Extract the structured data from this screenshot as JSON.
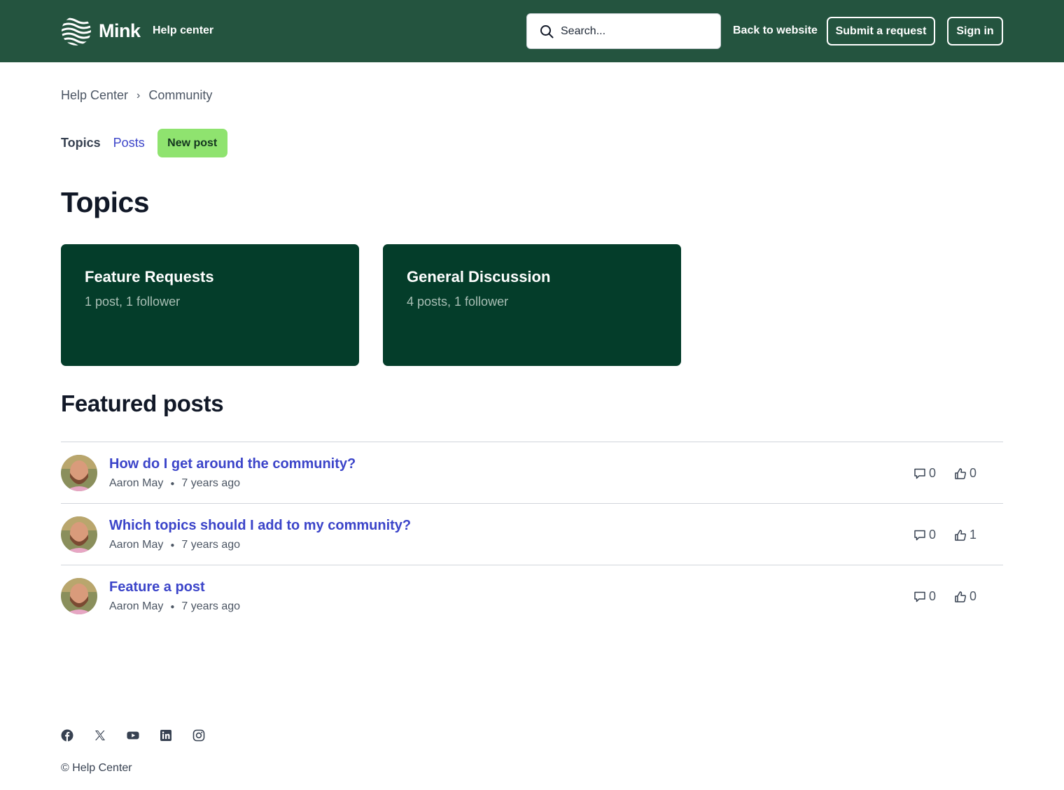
{
  "header": {
    "brand": "Mink",
    "help_center": "Help center",
    "search_placeholder": "Search...",
    "back_to_website": "Back to website",
    "submit_request": "Submit a request",
    "sign_in": "Sign in",
    "colors": {
      "header_bg": "#24543f",
      "card_bg": "#043d2a",
      "accent_button": "#8fe36f",
      "link": "#3b44c9"
    }
  },
  "breadcrumb": {
    "items": [
      "Help Center",
      "Community"
    ],
    "separator": "›"
  },
  "subnav": {
    "topics": "Topics",
    "posts": "Posts",
    "new_post": "New post"
  },
  "topics": {
    "heading": "Topics",
    "cards": [
      {
        "title": "Feature Requests",
        "meta": "1 post, 1 follower"
      },
      {
        "title": "General Discussion",
        "meta": "4 posts, 1 follower"
      }
    ]
  },
  "featured": {
    "heading": "Featured posts",
    "posts": [
      {
        "title": "How do I get around the community?",
        "author": "Aaron May",
        "time": "7 years ago",
        "comments": "0",
        "votes": "0"
      },
      {
        "title": "Which topics should I add to my community?",
        "author": "Aaron May",
        "time": "7 years ago",
        "comments": "0",
        "votes": "1"
      },
      {
        "title": "Feature a post",
        "author": "Aaron May",
        "time": "7 years ago",
        "comments": "0",
        "votes": "0"
      }
    ]
  },
  "footer": {
    "social_icons": [
      "facebook-icon",
      "x-icon",
      "youtube-icon",
      "linkedin-icon",
      "instagram-icon"
    ],
    "copyright": "© Help Center"
  }
}
